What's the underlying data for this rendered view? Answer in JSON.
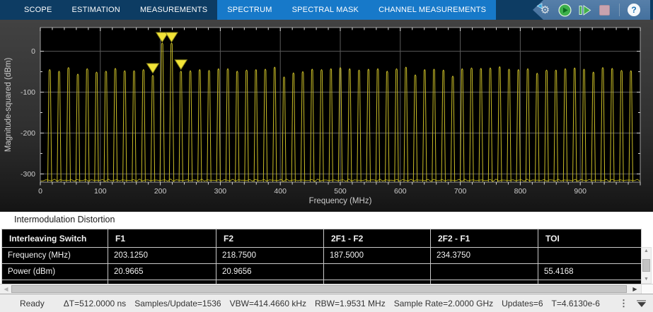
{
  "toolbar": {
    "tabs": [
      {
        "label": "SCOPE",
        "selected": false
      },
      {
        "label": "ESTIMATION",
        "selected": false
      },
      {
        "label": "MEASUREMENTS",
        "selected": false
      },
      {
        "label": "SPECTRUM",
        "selected": true
      },
      {
        "label": "SPECTRAL MASK",
        "selected": true
      },
      {
        "label": "CHANNEL MEASUREMENTS",
        "selected": true
      }
    ],
    "help_label": "?",
    "colors": {
      "bar": "#0d3c63",
      "tab_highlight": "#1779c9",
      "banner": "#44719e"
    }
  },
  "chart_data": {
    "type": "line",
    "title": "",
    "xlabel": "Frequency (MHz)",
    "ylabel": "Magnitude-squared (dBm)",
    "xlim": [
      0,
      1000
    ],
    "ylim": [
      -320,
      58
    ],
    "xticks": [
      0,
      100,
      200,
      300,
      400,
      500,
      600,
      700,
      800,
      900
    ],
    "yticks": [
      0,
      -100,
      -200,
      -300
    ],
    "grid": true,
    "legend": false,
    "line_color": "#c9bd27",
    "marker_color": "#f2e437",
    "background": "#000000",
    "comb_spacing_mhz": 15.625,
    "peaks": [
      {
        "f": 15.625,
        "v": -44
      },
      {
        "f": 31.25,
        "v": -48
      },
      {
        "f": 46.875,
        "v": -39
      },
      {
        "f": 62.5,
        "v": -55
      },
      {
        "f": 78.125,
        "v": -42
      },
      {
        "f": 93.75,
        "v": -50
      },
      {
        "f": 109.375,
        "v": -48
      },
      {
        "f": 125,
        "v": -41
      },
      {
        "f": 140.625,
        "v": -47
      },
      {
        "f": 156.25,
        "v": -47
      },
      {
        "f": 171.875,
        "v": -44
      },
      {
        "f": 187.5,
        "v": -58
      },
      {
        "f": 203.125,
        "v": 20.97
      },
      {
        "f": 218.75,
        "v": 20.97
      },
      {
        "f": 234.375,
        "v": -48
      },
      {
        "f": 250,
        "v": -47
      },
      {
        "f": 265.625,
        "v": -44
      },
      {
        "f": 281.25,
        "v": -46
      },
      {
        "f": 296.875,
        "v": -42
      },
      {
        "f": 312.5,
        "v": -42
      },
      {
        "f": 328.125,
        "v": -48
      },
      {
        "f": 343.75,
        "v": -45
      },
      {
        "f": 359.375,
        "v": -44
      },
      {
        "f": 375,
        "v": -43
      },
      {
        "f": 390.625,
        "v": -38
      },
      {
        "f": 406.25,
        "v": -62
      },
      {
        "f": 421.875,
        "v": -52
      },
      {
        "f": 437.5,
        "v": -49
      },
      {
        "f": 453.125,
        "v": -43
      },
      {
        "f": 468.75,
        "v": -44
      },
      {
        "f": 484.375,
        "v": -42
      },
      {
        "f": 500,
        "v": -39
      },
      {
        "f": 515.625,
        "v": -42
      },
      {
        "f": 531.25,
        "v": -45
      },
      {
        "f": 546.875,
        "v": -43
      },
      {
        "f": 562.5,
        "v": -42
      },
      {
        "f": 578.125,
        "v": -48
      },
      {
        "f": 593.75,
        "v": -42
      },
      {
        "f": 609.375,
        "v": -38
      },
      {
        "f": 625,
        "v": -57
      },
      {
        "f": 640.625,
        "v": -44
      },
      {
        "f": 656.25,
        "v": -43
      },
      {
        "f": 671.875,
        "v": -45
      },
      {
        "f": 687.5,
        "v": -60
      },
      {
        "f": 703.125,
        "v": -42
      },
      {
        "f": 718.75,
        "v": -40
      },
      {
        "f": 734.375,
        "v": -41
      },
      {
        "f": 750,
        "v": -40
      },
      {
        "f": 765.625,
        "v": -37
      },
      {
        "f": 781.25,
        "v": -43
      },
      {
        "f": 796.875,
        "v": -44
      },
      {
        "f": 812.5,
        "v": -42
      },
      {
        "f": 828.125,
        "v": -53
      },
      {
        "f": 843.75,
        "v": -45
      },
      {
        "f": 859.375,
        "v": -45
      },
      {
        "f": 875,
        "v": -42
      },
      {
        "f": 890.625,
        "v": -40
      },
      {
        "f": 906.25,
        "v": -43
      },
      {
        "f": 921.875,
        "v": -50
      },
      {
        "f": 937.5,
        "v": -39
      },
      {
        "f": 953.125,
        "v": -41
      },
      {
        "f": 968.75,
        "v": -46
      },
      {
        "f": 984.375,
        "v": -47
      }
    ],
    "markers": [
      {
        "f": 187.5,
        "v": -55
      },
      {
        "f": 203.125,
        "v": 20.9665
      },
      {
        "f": 218.75,
        "v": 20.9656
      },
      {
        "f": 234.375,
        "v": -46
      }
    ]
  },
  "measurements": {
    "title": "Intermodulation Distortion",
    "table": {
      "columns": [
        "Interleaving Switch",
        "F1",
        "F2",
        "2F1 - F2",
        "2F2 - F1",
        "TOI"
      ],
      "rows": [
        {
          "label": "Frequency (MHz)",
          "values": [
            "203.1250",
            "218.7500",
            "187.5000",
            "234.3750",
            ""
          ]
        },
        {
          "label": "Power (dBm)",
          "values": [
            "20.9665",
            "20.9656",
            "",
            "",
            "55.4168"
          ]
        }
      ]
    }
  },
  "status_bar": {
    "state": "Ready",
    "stats": [
      "ΔT=512.0000 ns",
      "Samples/Update=1536",
      "VBW=414.4660 kHz",
      "RBW=1.9531 MHz",
      "Sample Rate=2.0000 GHz",
      "Updates=6",
      "T=4.6130e-6"
    ]
  }
}
